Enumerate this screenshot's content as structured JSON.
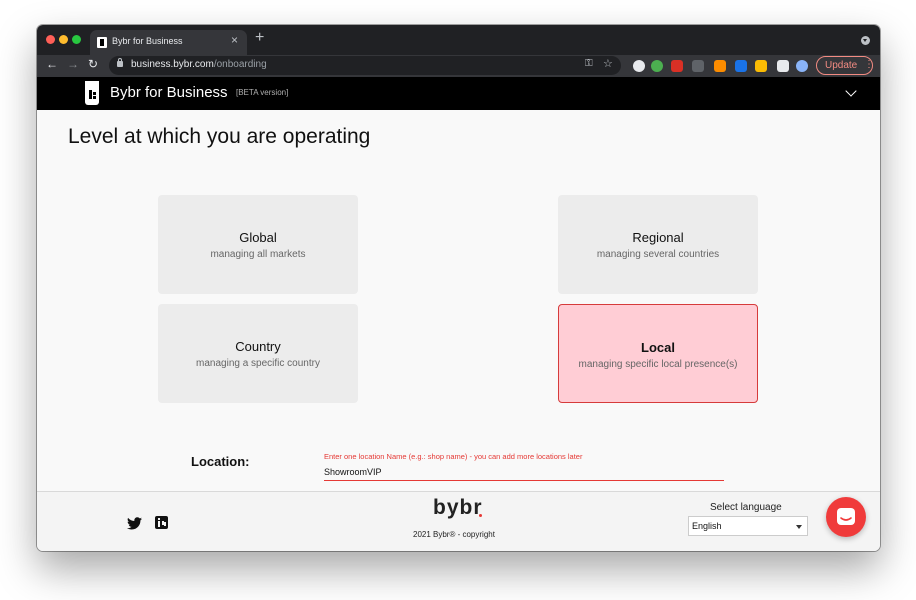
{
  "browser": {
    "tab_title": "Bybr for Business",
    "tab_close": "×",
    "new_tab": "+",
    "url_host": "business.bybr.com",
    "url_path": "/onboarding",
    "update_label": "Update",
    "update_menu": "⋮",
    "nav_back": "←",
    "nav_forward": "→",
    "nav_reload": "↻",
    "key_glyph": "⚿",
    "star_glyph": "☆"
  },
  "app": {
    "title": "Bybr for Business",
    "beta": "[BETA version]"
  },
  "main": {
    "heading": "Level at which you are operating",
    "cards": [
      {
        "title": "Global",
        "subtitle": "managing all markets"
      },
      {
        "title": "Regional",
        "subtitle": "managing several countries"
      },
      {
        "title": "Country",
        "subtitle": "managing a specific country"
      },
      {
        "title": "Local",
        "subtitle": "managing specific local presence(s)"
      }
    ],
    "selected_card": "Local",
    "location": {
      "label": "Location:",
      "hint": "Enter one location Name (e.g.: shop name) - you can add more locations later",
      "value": "ShowroomVIP"
    }
  },
  "footer": {
    "brand": "bybr",
    "copyright": "2021 Bybr® - copyright",
    "language_label": "Select language",
    "language_value": "English"
  },
  "colors": {
    "accent": "#e53935",
    "selected_card_bg": "#ffcdd5",
    "appbar_bg": "#000000"
  },
  "icons": [
    "twitter-icon",
    "linkedin-icon",
    "chat-icon",
    "lock-icon",
    "star-icon",
    "key-icon"
  ]
}
